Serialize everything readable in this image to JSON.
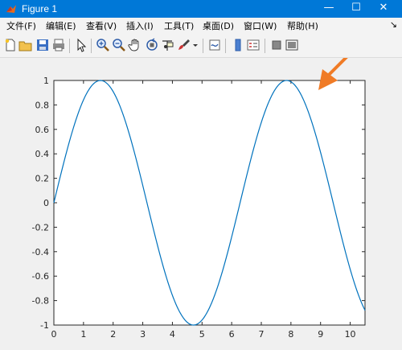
{
  "window": {
    "title": "Figure 1",
    "minimize": "—",
    "maximize": "☐",
    "close": "✕"
  },
  "menu": {
    "items": [
      "文件(F)",
      "编辑(E)",
      "查看(V)",
      "插入(I)",
      "工具(T)",
      "桌面(D)",
      "窗口(W)",
      "帮助(H)"
    ],
    "dock_icon": "↘"
  },
  "toolbar": {
    "icons": [
      "new-figure-icon",
      "open-file-icon",
      "save-icon",
      "print-icon",
      "edit-plot-arrow-icon",
      "zoom-in-icon",
      "zoom-out-icon",
      "pan-hand-icon",
      "rotate-3d-icon",
      "data-cursor-icon",
      "brush-icon",
      "dropdown-arrow-icon",
      "link-plot-icon",
      "colorbar-icon",
      "legend-icon",
      "hide-plot-tools-icon",
      "show-plot-tools-icon"
    ]
  },
  "annotation": {
    "color": "#f07b26",
    "icon": "orange-arrow-icon"
  },
  "chart_data": {
    "type": "line",
    "title": "",
    "xlabel": "",
    "ylabel": "",
    "xlim": [
      0,
      10.5
    ],
    "ylim": [
      -1,
      1
    ],
    "xticks": [
      0,
      1,
      2,
      3,
      4,
      5,
      6,
      7,
      8,
      9,
      10
    ],
    "yticks": [
      -1,
      -0.8,
      -0.6,
      -0.4,
      -0.2,
      0,
      0.2,
      0.4,
      0.6,
      0.8,
      1
    ],
    "ytick_labels": [
      "-1",
      "-0.8",
      "-0.6",
      "-0.4",
      "-0.2",
      "0",
      "0.2",
      "0.4",
      "0.6",
      "0.8",
      "1"
    ],
    "grid": false,
    "series": [
      {
        "function": "sin(x)",
        "x": [
          0,
          0.5,
          1,
          1.5,
          2,
          2.5,
          3,
          3.5,
          4,
          4.5,
          5,
          5.5,
          6,
          6.5,
          7,
          7.5,
          8,
          8.5,
          9,
          9.5,
          10,
          10.5
        ],
        "values": [
          0,
          0.479,
          0.841,
          0.997,
          0.909,
          0.598,
          0.141,
          -0.351,
          -0.757,
          -0.978,
          -0.959,
          -0.706,
          -0.279,
          0.215,
          0.657,
          0.938,
          0.989,
          0.798,
          0.412,
          -0.075,
          -0.544,
          -0.88
        ],
        "color": "#0072bd"
      }
    ]
  }
}
